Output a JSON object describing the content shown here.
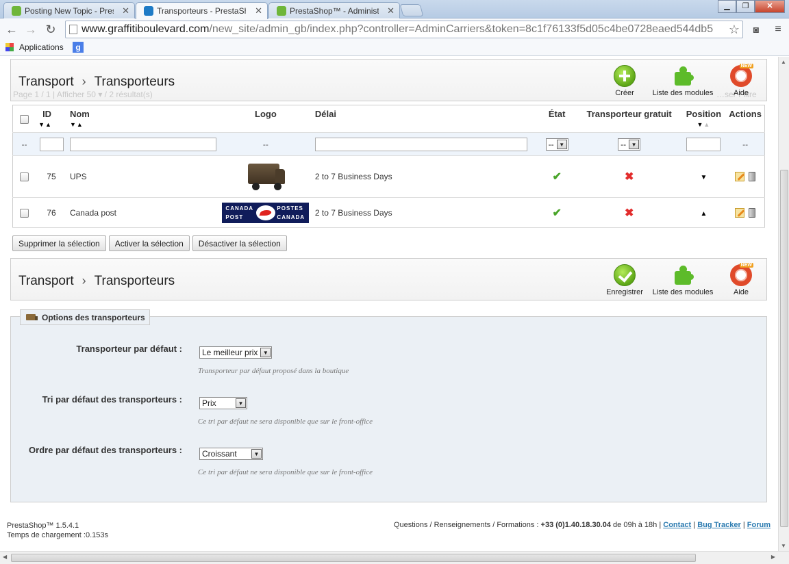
{
  "browser": {
    "tabs": [
      {
        "title": "Posting New Topic - Prest",
        "active": false,
        "favicon_color": "#6fb63a"
      },
      {
        "title": "Transporteurs - PrestaSho",
        "active": true,
        "favicon_color": "#1e7bc6"
      },
      {
        "title": "PrestaShop™ - Administra",
        "active": false,
        "favicon_color": "#6fb63a"
      }
    ],
    "url_host": "www.graffitiboulevard.com",
    "url_path": "/new_site/admin_gb/index.php?controller=AdminCarriers&token=8c1f76133f5d05c4be0728eaed544db5",
    "bookmark_apps": "Applications"
  },
  "header_top": {
    "crumb_section": "Transport",
    "crumb_page": "Transporteurs",
    "buttons": {
      "create": "Créer",
      "modules": "Liste des modules",
      "help": "Aide"
    },
    "ghost_pagination": "Page 1 / 1 | Afficher  50  ▾ / 2 résultat(s)",
    "ghost_right": "…ser  Filtre"
  },
  "table": {
    "headers": {
      "id": "ID",
      "name": "Nom",
      "logo": "Logo",
      "delay": "Délai",
      "state": "État",
      "free": "Transporteur gratuit",
      "position": "Position",
      "actions": "Actions"
    },
    "filter": {
      "dash": "--",
      "state_value": "--",
      "free_value": "--"
    },
    "rows": [
      {
        "id": "75",
        "name": "UPS",
        "logo": "ups-truck",
        "delay": "2 to 7 Business Days",
        "state_icon": "✔",
        "free_icon": "✖",
        "position_icon": "▼"
      },
      {
        "id": "76",
        "name": "Canada post",
        "logo": "canada-post",
        "delay": "2 to 7 Business Days",
        "state_icon": "✔",
        "free_icon": "✖",
        "position_icon": "▲"
      }
    ]
  },
  "canada_post_logo": {
    "tl": "CANADA",
    "bl": "POST",
    "tr": "POSTES",
    "br": "CANADA"
  },
  "bulk": {
    "delete": "Supprimer la sélection",
    "enable": "Activer la sélection",
    "disable": "Désactiver la sélection"
  },
  "header_bottom": {
    "crumb_section": "Transport",
    "crumb_page": "Transporteurs",
    "buttons": {
      "save": "Enregistrer",
      "modules": "Liste des modules",
      "help": "Aide"
    }
  },
  "options": {
    "legend": "Options des transporteurs",
    "fields": [
      {
        "label": "Transporteur par défaut :",
        "value": "Le meilleur prix",
        "hint": "Transporteur par défaut proposé dans la boutique"
      },
      {
        "label": "Tri par défaut des transporteurs :",
        "value": "Prix",
        "hint": "Ce tri par défaut ne sera disponible que sur le front-office"
      },
      {
        "label": "Ordre par défaut des transporteurs :",
        "value": "Croissant",
        "hint": "Ce tri par défaut ne sera disponible que sur le front-office"
      }
    ]
  },
  "footer": {
    "version": "PrestaShop™ 1.5.4.1",
    "load_time": "Temps de chargement :0.153s",
    "info_prefix": "Questions / Renseignements / Formations : ",
    "phone": "+33 (0)1.40.18.30.04",
    "hours": " de 09h à 18h | ",
    "contact": "Contact",
    "bug": "Bug Tracker",
    "forum": "Forum"
  },
  "colors": {
    "green": "#5da616",
    "red": "#e22c2c",
    "link": "#2a7ab0",
    "panel": "#ebf0f5"
  }
}
